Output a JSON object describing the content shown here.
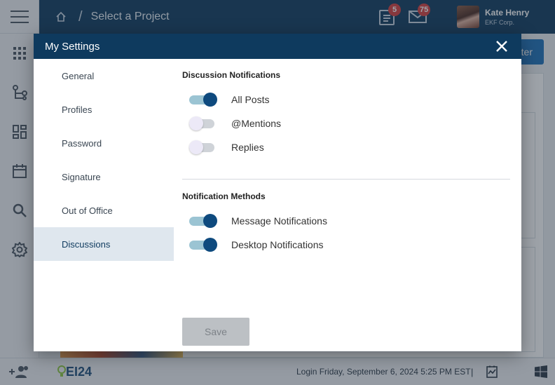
{
  "topbar": {
    "breadcrumb_title": "Select a Project",
    "tasks_badge": "5",
    "mail_badge": "75",
    "user_name": "Kate Henry",
    "user_org": "EKF Corp."
  },
  "background": {
    "filter_button_label": "ter"
  },
  "footer": {
    "brand": "EI24",
    "login_text": "Login Friday, September 6, 2024 5:25 PM EST",
    "separator": "|"
  },
  "modal": {
    "title": "My Settings",
    "nav": [
      {
        "label": "General",
        "active": false
      },
      {
        "label": "Profiles",
        "active": false
      },
      {
        "label": "Password",
        "active": false
      },
      {
        "label": "Signature",
        "active": false
      },
      {
        "label": "Out of Office",
        "active": false
      },
      {
        "label": "Discussions",
        "active": true
      }
    ],
    "discussion_section": {
      "title": "Discussion Notifications",
      "toggles": [
        {
          "label": "All Posts",
          "on": true
        },
        {
          "label": "@Mentions",
          "on": false
        },
        {
          "label": "Replies",
          "on": false
        }
      ]
    },
    "methods_section": {
      "title": "Notification Methods",
      "toggles": [
        {
          "label": "Message Notifications",
          "on": true
        },
        {
          "label": "Desktop Notifications",
          "on": true
        }
      ]
    },
    "save_label": "Save"
  },
  "colors": {
    "header_navy": "#0e3a5e",
    "toggle_on_knob": "#0e4a7e",
    "toggle_on_track": "#9bc4d3",
    "badge_red": "#d33c3c",
    "nav_active_bg": "#dfe7ee"
  }
}
